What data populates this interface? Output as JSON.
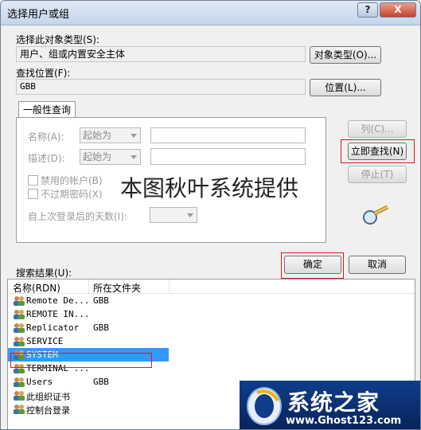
{
  "window": {
    "title": "选择用户或组",
    "help_label": "?",
    "close_label": "X"
  },
  "object_type": {
    "label": "选择此对象类型(S):",
    "value": "用户、组或内置安全主体",
    "button": "对象类型(O)..."
  },
  "location": {
    "label": "查找位置(F):",
    "value": "GBB",
    "button": "位置(L)..."
  },
  "general_query": {
    "tab_label": "一般性查询",
    "name_label": "名称(A):",
    "name_combo": "起始为",
    "desc_label": "描述(D):",
    "desc_combo": "起始为",
    "disabled_accounts": "禁用的帐户(B)",
    "non_expiring_pw": "不过期密码(X)",
    "days_since_logon": "自上次登录后的天数(I):"
  },
  "side_buttons": {
    "columns": "列(C)...",
    "find_now": "立即查找(N)",
    "stop": "停止(T)"
  },
  "watermark": "本图秋叶系统提供",
  "dialog_buttons": {
    "ok": "确定",
    "cancel": "取消"
  },
  "results": {
    "label": "搜索结果(U):",
    "columns": [
      "名称(RDN)",
      "所在文件夹"
    ],
    "rows": [
      {
        "name": "Remote De...",
        "folder": "GBB"
      },
      {
        "name": "REMOTE IN...",
        "folder": ""
      },
      {
        "name": "Replicator",
        "folder": "GBB"
      },
      {
        "name": "SERVICE",
        "folder": ""
      },
      {
        "name": "SYSTEM",
        "folder": ""
      },
      {
        "name": "TERMINAL ...",
        "folder": ""
      },
      {
        "name": "Users",
        "folder": "GBB"
      },
      {
        "name": "此组织证书",
        "folder": ""
      },
      {
        "name": "控制台登录",
        "folder": ""
      }
    ],
    "selected_index": 4
  },
  "logo": {
    "text": "系统之家",
    "url": "www.Ghost123.com"
  },
  "colors": {
    "highlight_box": "#d71920",
    "selection": "#3399ff"
  }
}
